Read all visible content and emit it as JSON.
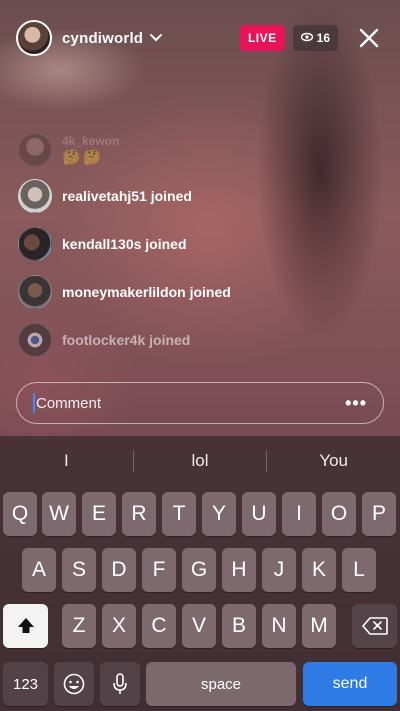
{
  "host": {
    "username": "cyndiworld"
  },
  "badges": {
    "live": "LIVE",
    "viewers": "16"
  },
  "icons": {
    "chevron": "chevron-down-icon",
    "eye": "eye-icon",
    "close": "close-icon",
    "shift": "shift-icon",
    "backspace": "backspace-icon",
    "emoji": "emoji-icon",
    "mic": "microphone-icon",
    "more": "more-icon"
  },
  "feed": {
    "top_user": "4k_kewon",
    "top_emojis": "🤔🤔",
    "items": [
      {
        "text": "realivetahj51 joined"
      },
      {
        "text": "kendall130s joined"
      },
      {
        "text": "moneymakerlildon joined"
      },
      {
        "text": "footlocker4k joined"
      }
    ]
  },
  "comment": {
    "placeholder": "Comment",
    "more": "•••"
  },
  "keyboard": {
    "suggestions": [
      "I",
      "lol",
      "You"
    ],
    "row1": [
      "Q",
      "W",
      "E",
      "R",
      "T",
      "Y",
      "U",
      "I",
      "O",
      "P"
    ],
    "row2": [
      "A",
      "S",
      "D",
      "F",
      "G",
      "H",
      "J",
      "K",
      "L"
    ],
    "row3": [
      "Z",
      "X",
      "C",
      "V",
      "B",
      "N",
      "M"
    ],
    "numbers": "123",
    "space": "space",
    "send": "send"
  },
  "colors": {
    "live": "#e7145a",
    "send": "#2f7be6",
    "caret": "#3d8bff"
  }
}
